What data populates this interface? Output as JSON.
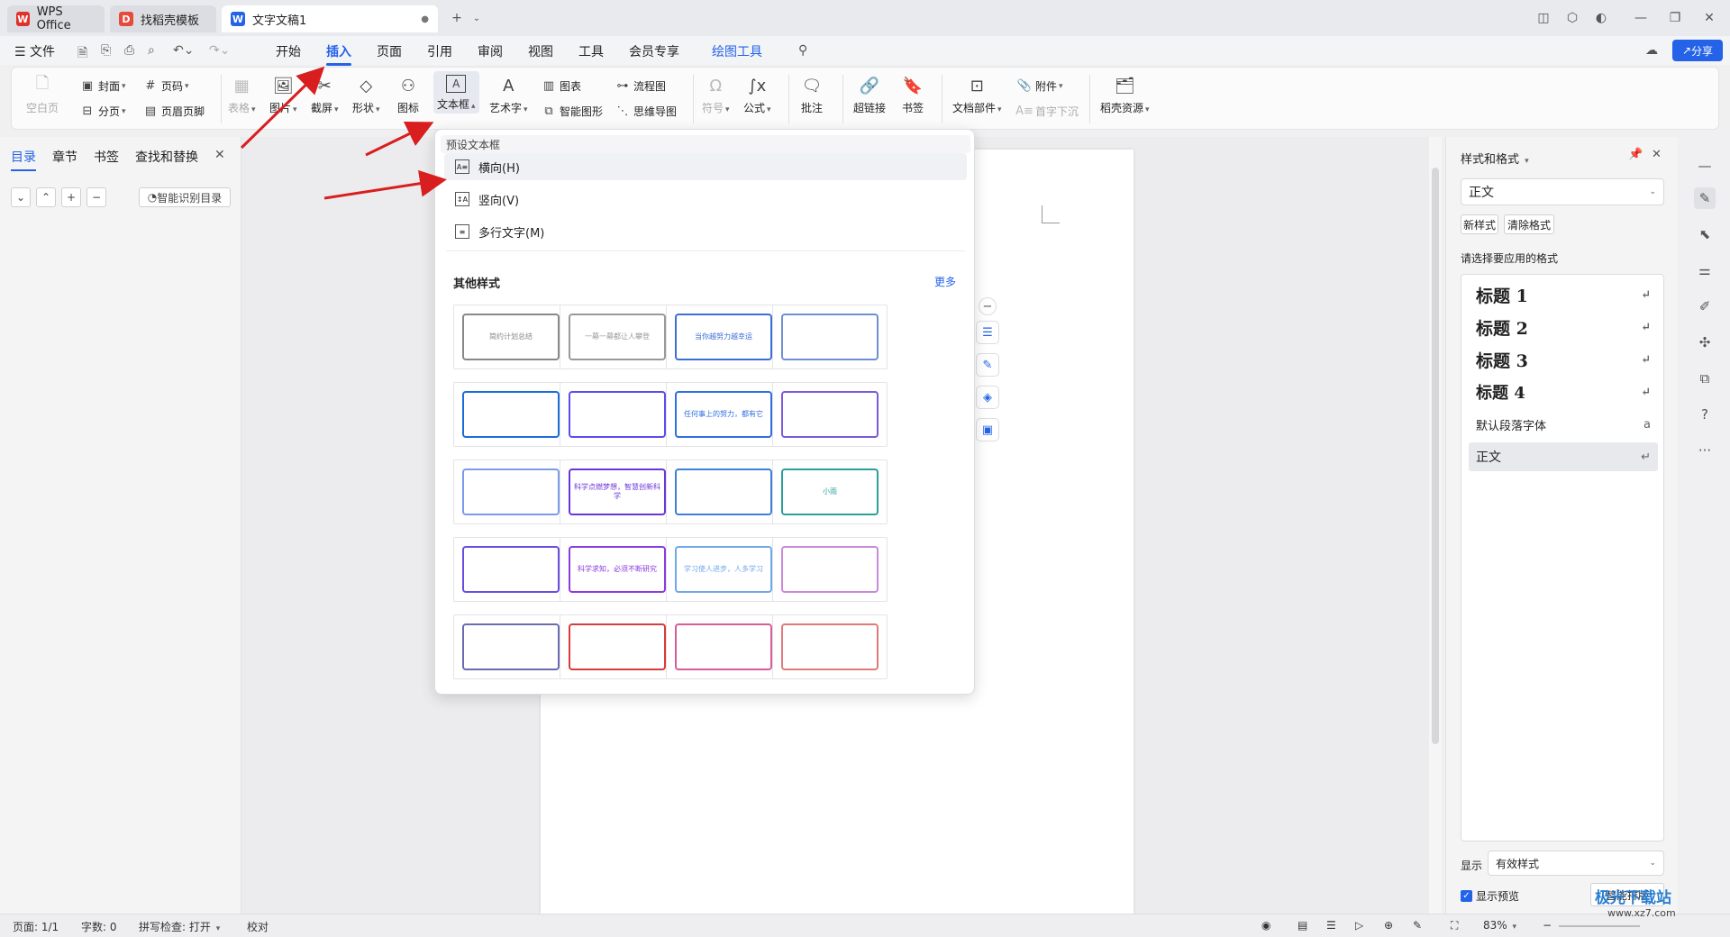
{
  "tabs": [
    {
      "label": "WPS Office",
      "icon": "wps-logo-icon"
    },
    {
      "label": "找稻壳模板",
      "icon": "docer-icon"
    },
    {
      "label": "文字文稿1",
      "icon": "writer-doc-icon"
    }
  ],
  "menu": {
    "file": "文件",
    "items": [
      "开始",
      "插入",
      "页面",
      "引用",
      "审阅",
      "视图",
      "工具",
      "会员专享",
      "绘图工具"
    ],
    "selected": "插入",
    "share": "分享"
  },
  "ribbon": {
    "blank_page": "空白页",
    "cover": "封面",
    "page_break": "分页",
    "page_number": "页码",
    "header_footer": "页眉页脚",
    "table": "表格",
    "picture": "图片",
    "screenshot": "截屏",
    "shape": "形状",
    "icon": "图标",
    "textbox": "文本框",
    "wordart": "艺术字",
    "chart": "图表",
    "smart_graphic": "智能图形",
    "flowchart": "流程图",
    "mindmap": "思维导图",
    "symbol": "符号",
    "formula": "公式",
    "comment": "批注",
    "hyperlink": "超链接",
    "bookmark": "书签",
    "doc_parts": "文档部件",
    "attachment": "附件",
    "drop_cap": "首字下沉",
    "docer_resources": "稻壳资源"
  },
  "nav": {
    "tabs": [
      "目录",
      "章节",
      "书签",
      "查找和替换"
    ],
    "smart_toc": "智能识别目录"
  },
  "dropdown": {
    "preset_header": "预设文本框",
    "items": [
      "横向(H)",
      "竖向(V)",
      "多行文字(M)"
    ],
    "other_header": "其他样式",
    "more": "更多",
    "thumbs": [
      "简约计划总结",
      "一幕一幕都让人攀登",
      "当你越努力越幸运",
      "",
      "",
      "",
      "任何事上的努力，都有它",
      "",
      "",
      "科学点燃梦想，智慧创新科学",
      "",
      "小雨",
      "",
      "科学求知，必须不断研究",
      "学习使人进步，人多学习",
      "",
      "",
      "",
      "",
      ""
    ]
  },
  "styles": {
    "panel_title": "样式和格式",
    "current": "正文",
    "new_style": "新样式",
    "clear_format": "清除格式",
    "prompt": "请选择要应用的格式",
    "list": [
      "标题 1",
      "标题 2",
      "标题 3",
      "标题 4",
      "默认段落字体",
      "正文"
    ],
    "show_label": "显示",
    "show_value": "有效样式",
    "preview": "显示预览",
    "smart_layout": "智能排版"
  },
  "status": {
    "page": "页面: 1/1",
    "words": "字数: 0",
    "spell": "拼写检查: 打开",
    "proof": "校对",
    "zoom": "83%"
  },
  "watermark": {
    "main": "极光下载站",
    "sub": "www.xz7.com"
  },
  "colors": {
    "accent": "#2462e8",
    "wps_red": "#e0322b",
    "arrow_red": "#d81e1e"
  }
}
